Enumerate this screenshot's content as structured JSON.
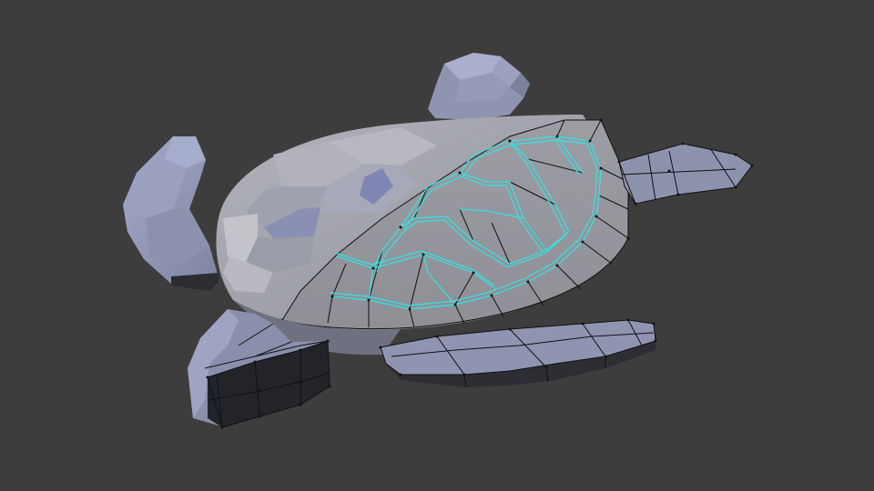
{
  "viewport": {
    "mode": "Edit Mode",
    "object": "sea-turtle-mesh"
  },
  "colors": {
    "background": "#3d3d3d",
    "mesh_light": "#9aa1c0",
    "mesh_face": "#8d90a6",
    "mesh_shadow": "#2b2d33",
    "shell_solid": "#a5a6ad",
    "shell_mesh": "#9c9ca3",
    "wire": "#111111",
    "seam": "#2ee6e6"
  },
  "parts": [
    "shell",
    "head",
    "front-left-flipper",
    "front-right-flipper",
    "rear-left-flipper",
    "rear-right-flipper"
  ]
}
